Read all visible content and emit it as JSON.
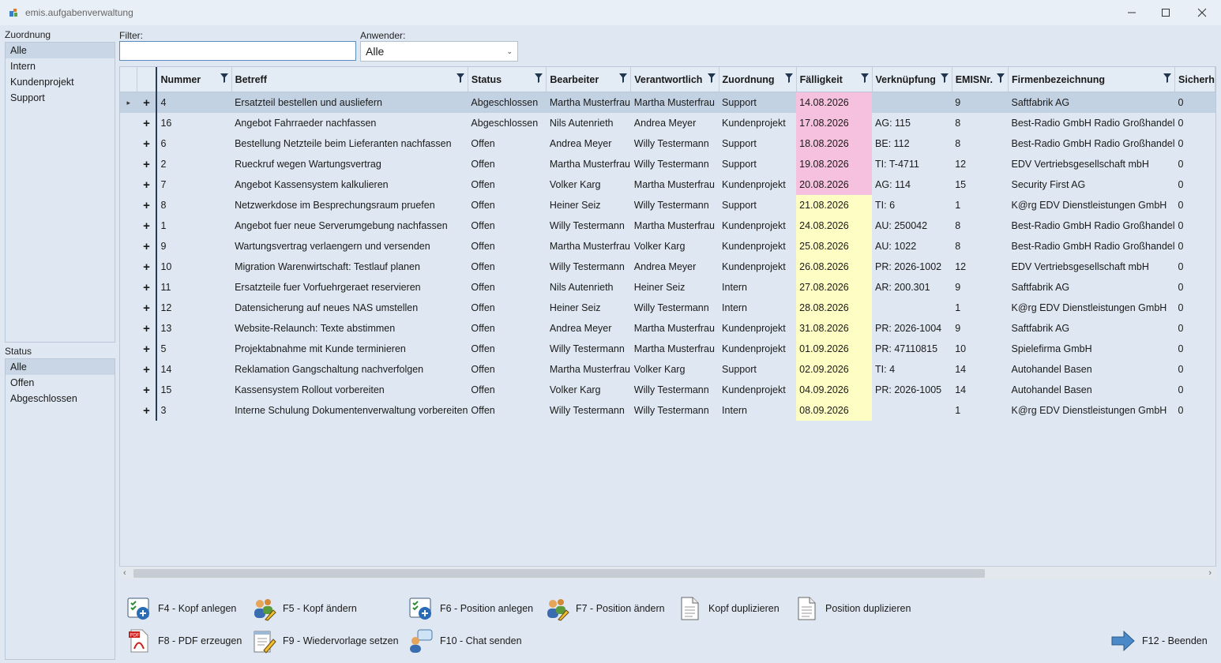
{
  "window": {
    "title": "emis.aufgabenverwaltung"
  },
  "zuordnung": {
    "label": "Zuordnung",
    "items": [
      "Alle",
      "Intern",
      "Kundenprojekt",
      "Support"
    ],
    "selected": "Alle"
  },
  "status": {
    "label": "Status",
    "items": [
      "Alle",
      "Offen",
      "Abgeschlossen"
    ],
    "selected": "Alle"
  },
  "filter": {
    "label": "Filter:",
    "value": ""
  },
  "anwender": {
    "label": "Anwender:",
    "value": "Alle"
  },
  "grid": {
    "columns": [
      "Nummer",
      "Betreff",
      "Status",
      "Bearbeiter",
      "Verantwortlich",
      "Zuordnung",
      "Fälligkeit",
      "Verknüpfung",
      "EMISNr.",
      "Firmenbezeichnung",
      "Sicherh"
    ],
    "rows": [
      {
        "nummer": "4",
        "betreff": "Ersatzteil bestellen und ausliefern",
        "status": "Abgeschlossen",
        "bearbeiter": "Martha Musterfrau",
        "verantwortlich": "Martha Musterfrau",
        "zuordnung": "Support",
        "faelligkeit": "14.08.2026",
        "verknuepfung": "",
        "emisnr": "9",
        "firma": "Saftfabrik AG",
        "sicherh": "0",
        "due": "red",
        "selected": true
      },
      {
        "nummer": "16",
        "betreff": "Angebot Fahrraeder nachfassen",
        "status": "Abgeschlossen",
        "bearbeiter": "Nils Autenrieth",
        "verantwortlich": "Andrea Meyer",
        "zuordnung": "Kundenprojekt",
        "faelligkeit": "17.08.2026",
        "verknuepfung": "AG: 115",
        "emisnr": "8",
        "firma": "Best-Radio GmbH Radio Großhandel",
        "sicherh": "0",
        "due": "red"
      },
      {
        "nummer": "6",
        "betreff": "Bestellung Netzteile beim Lieferanten nachfassen",
        "status": "Offen",
        "bearbeiter": "Andrea Meyer",
        "verantwortlich": "Willy Testermann",
        "zuordnung": "Support",
        "faelligkeit": "18.08.2026",
        "verknuepfung": "BE: 112",
        "emisnr": "8",
        "firma": "Best-Radio GmbH Radio Großhandel",
        "sicherh": "0",
        "due": "red"
      },
      {
        "nummer": "2",
        "betreff": "Rueckruf wegen Wartungsvertrag",
        "status": "Offen",
        "bearbeiter": "Martha Musterfrau",
        "verantwortlich": "Willy Testermann",
        "zuordnung": "Support",
        "faelligkeit": "19.08.2026",
        "verknuepfung": "TI: T-4711",
        "emisnr": "12",
        "firma": "EDV Vertriebsgesellschaft mbH",
        "sicherh": "0",
        "due": "red"
      },
      {
        "nummer": "7",
        "betreff": "Angebot Kassensystem kalkulieren",
        "status": "Offen",
        "bearbeiter": "Volker Karg",
        "verantwortlich": "Martha Musterfrau",
        "zuordnung": "Kundenprojekt",
        "faelligkeit": "20.08.2026",
        "verknuepfung": "AG: 114",
        "emisnr": "15",
        "firma": "Security First AG",
        "sicherh": "0",
        "due": "red"
      },
      {
        "nummer": "8",
        "betreff": "Netzwerkdose im Besprechungsraum pruefen",
        "status": "Offen",
        "bearbeiter": "Heiner Seiz",
        "verantwortlich": "Willy Testermann",
        "zuordnung": "Support",
        "faelligkeit": "21.08.2026",
        "verknuepfung": "TI: 6",
        "emisnr": "1",
        "firma": "K@rg EDV Dienstleistungen GmbH",
        "sicherh": "0",
        "due": "yel"
      },
      {
        "nummer": "1",
        "betreff": "Angebot fuer neue Serverumgebung nachfassen",
        "status": "Offen",
        "bearbeiter": "Willy Testermann",
        "verantwortlich": "Martha Musterfrau",
        "zuordnung": "Kundenprojekt",
        "faelligkeit": "24.08.2026",
        "verknuepfung": "AU: 250042",
        "emisnr": "8",
        "firma": "Best-Radio GmbH Radio Großhandel",
        "sicherh": "0",
        "due": "yel"
      },
      {
        "nummer": "9",
        "betreff": "Wartungsvertrag verlaengern und versenden",
        "status": "Offen",
        "bearbeiter": "Martha Musterfrau",
        "verantwortlich": "Volker Karg",
        "zuordnung": "Kundenprojekt",
        "faelligkeit": "25.08.2026",
        "verknuepfung": "AU: 1022",
        "emisnr": "8",
        "firma": "Best-Radio GmbH Radio Großhandel",
        "sicherh": "0",
        "due": "yel"
      },
      {
        "nummer": "10",
        "betreff": "Migration Warenwirtschaft: Testlauf planen",
        "status": "Offen",
        "bearbeiter": "Willy Testermann",
        "verantwortlich": "Andrea Meyer",
        "zuordnung": "Kundenprojekt",
        "faelligkeit": "26.08.2026",
        "verknuepfung": "PR: 2026-1002",
        "emisnr": "12",
        "firma": "EDV Vertriebsgesellschaft mbH",
        "sicherh": "0",
        "due": "yel"
      },
      {
        "nummer": "11",
        "betreff": "Ersatzteile fuer Vorfuehrgeraet reservieren",
        "status": "Offen",
        "bearbeiter": "Nils Autenrieth",
        "verantwortlich": "Heiner Seiz",
        "zuordnung": "Intern",
        "faelligkeit": "27.08.2026",
        "verknuepfung": "AR: 200.301",
        "emisnr": "9",
        "firma": "Saftfabrik AG",
        "sicherh": "0",
        "due": "yel"
      },
      {
        "nummer": "12",
        "betreff": "Datensicherung auf neues NAS umstellen",
        "status": "Offen",
        "bearbeiter": "Heiner Seiz",
        "verantwortlich": "Willy Testermann",
        "zuordnung": "Intern",
        "faelligkeit": "28.08.2026",
        "verknuepfung": "",
        "emisnr": "1",
        "firma": "K@rg EDV Dienstleistungen GmbH",
        "sicherh": "0",
        "due": "yel"
      },
      {
        "nummer": "13",
        "betreff": "Website-Relaunch: Texte abstimmen",
        "status": "Offen",
        "bearbeiter": "Andrea Meyer",
        "verantwortlich": "Martha Musterfrau",
        "zuordnung": "Kundenprojekt",
        "faelligkeit": "31.08.2026",
        "verknuepfung": "PR: 2026-1004",
        "emisnr": "9",
        "firma": "Saftfabrik AG",
        "sicherh": "0",
        "due": "yel"
      },
      {
        "nummer": "5",
        "betreff": "Projektabnahme mit Kunde terminieren",
        "status": "Offen",
        "bearbeiter": "Willy Testermann",
        "verantwortlich": "Martha Musterfrau",
        "zuordnung": "Kundenprojekt",
        "faelligkeit": "01.09.2026",
        "verknuepfung": "PR: 47110815",
        "emisnr": "10",
        "firma": "Spielefirma GmbH",
        "sicherh": "0",
        "due": "yel"
      },
      {
        "nummer": "14",
        "betreff": "Reklamation Gangschaltung nachverfolgen",
        "status": "Offen",
        "bearbeiter": "Martha Musterfrau",
        "verantwortlich": "Volker Karg",
        "zuordnung": "Support",
        "faelligkeit": "02.09.2026",
        "verknuepfung": "TI: 4",
        "emisnr": "14",
        "firma": "Autohandel Basen",
        "sicherh": "0",
        "due": "yel"
      },
      {
        "nummer": "15",
        "betreff": "Kassensystem Rollout vorbereiten",
        "status": "Offen",
        "bearbeiter": "Volker Karg",
        "verantwortlich": "Willy Testermann",
        "zuordnung": "Kundenprojekt",
        "faelligkeit": "04.09.2026",
        "verknuepfung": "PR: 2026-1005",
        "emisnr": "14",
        "firma": "Autohandel Basen",
        "sicherh": "0",
        "due": "yel"
      },
      {
        "nummer": "3",
        "betreff": "Interne Schulung Dokumentenverwaltung vorbereiten",
        "status": "Offen",
        "bearbeiter": "Willy Testermann",
        "verantwortlich": "Willy Testermann",
        "zuordnung": "Intern",
        "faelligkeit": "08.09.2026",
        "verknuepfung": "",
        "emisnr": "1",
        "firma": "K@rg EDV Dienstleistungen GmbH",
        "sicherh": "0",
        "due": "yel"
      }
    ]
  },
  "toolbar": {
    "f4": "F4 - Kopf anlegen",
    "f5": "F5 - Kopf ändern",
    "f6": "F6 - Position anlegen",
    "f7": "F7 - Position ändern",
    "kopf_dup": "Kopf duplizieren",
    "pos_dup": "Position duplizieren",
    "f8": "F8 - PDF erzeugen",
    "f9": "F9 - Wiedervorlage setzen",
    "f10": "F10 - Chat senden",
    "f12": "F12 - Beenden"
  },
  "colors": {
    "due_overdue": "#f6c1de",
    "due_upcoming": "#fefec4",
    "selection": "#c3d2e3",
    "accent": "#3a7ec8"
  },
  "icons": {
    "expand": "plus-icon",
    "row_pointer": "row-pointer-icon",
    "column_filter": "filter-icon"
  }
}
